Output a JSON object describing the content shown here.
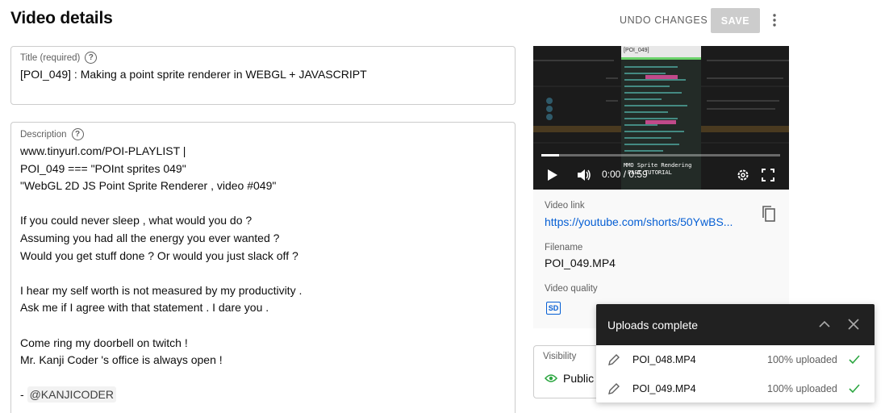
{
  "header": {
    "title": "Video details",
    "undo_label": "UNDO CHANGES",
    "save_label": "SAVE"
  },
  "title_field": {
    "label": "Title (required)",
    "value": "[POI_049] : Making a point sprite renderer in WEBGL + JAVASCRIPT"
  },
  "description_field": {
    "label": "Description",
    "lines": [
      "www.tinyurl.com/POI-PLAYLIST |",
      "POI_049 === \"POInt sprites 049\"",
      "\"WebGL 2D JS Point Sprite Renderer , video #049\"",
      "",
      "If you could never sleep , what would you do ?",
      "Assuming you had all the energy you ever wanted ?",
      "Would you get stuff done ? Or would you just slack off ?",
      "",
      "I hear my self worth is not measured by my productivity .",
      "Ask me if I agree with that statement . I dare you .",
      "",
      "Come ring my doorbell on twitch !",
      "Mr. Kanji Coder 's office is always open !",
      "",
      "- "
    ],
    "mention": "@KANJICODER"
  },
  "video": {
    "time": "0:00 / 0:59",
    "progress": 0,
    "overlay_title": "[POI_049]",
    "overlay_caption": "MMO Sprite Rendering",
    "overlay_caption2": "PAST TUTORIAL"
  },
  "details": {
    "link_label": "Video link",
    "link_value": "https://youtube.com/shorts/50YwBS...",
    "filename_label": "Filename",
    "filename_value": "POI_049.MP4",
    "quality_label": "Video quality",
    "quality_badge": "SD"
  },
  "visibility": {
    "label": "Visibility",
    "value": "Public"
  },
  "uploads": {
    "title": "Uploads complete",
    "items": [
      {
        "filename": "POI_048.MP4",
        "status": "100% uploaded"
      },
      {
        "filename": "POI_049.MP4",
        "status": "100% uploaded"
      }
    ]
  },
  "colors": {
    "link": "#065fd4",
    "success": "#2ba640",
    "save_disabled": "#cccccc",
    "panel_header": "#212121"
  },
  "icons": [
    "help-icon",
    "more-vert-icon",
    "play-icon",
    "volume-icon",
    "settings-icon",
    "fullscreen-icon",
    "copy-icon",
    "sd-icon",
    "eye-icon",
    "chevron-up-icon",
    "close-icon",
    "pencil-icon",
    "check-icon"
  ]
}
